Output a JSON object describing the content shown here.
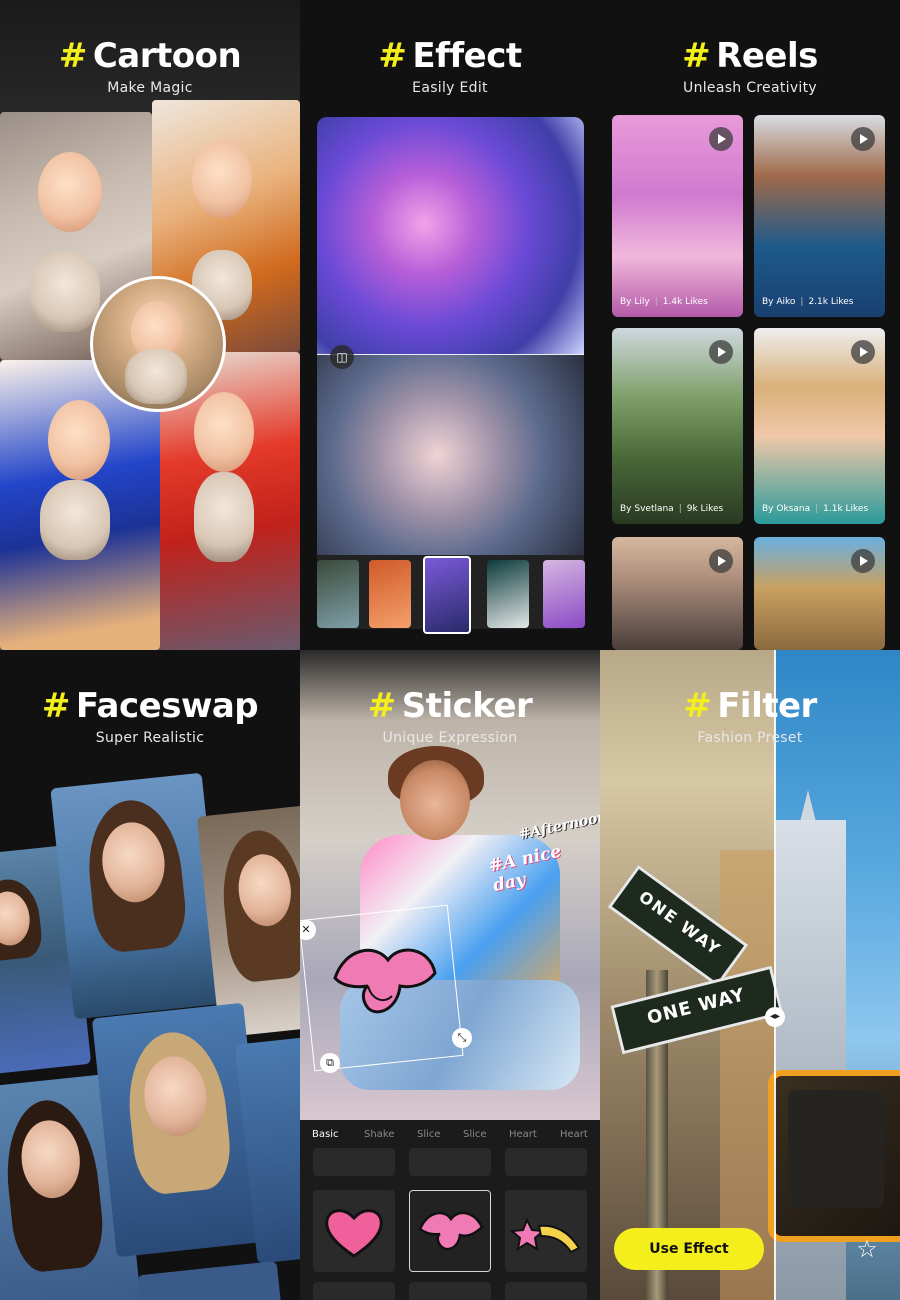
{
  "panels": [
    {
      "hash": "#",
      "title": "Cartoon",
      "subtitle": "Make Magic"
    },
    {
      "hash": "#",
      "title": "Effect",
      "subtitle": "Easily Edit"
    },
    {
      "hash": "#",
      "title": "Reels",
      "subtitle": "Unleash Creativity"
    },
    {
      "hash": "#",
      "title": "Faceswap",
      "subtitle": "Super Realistic"
    },
    {
      "hash": "#",
      "title": "Sticker",
      "subtitle": "Unique Expression"
    },
    {
      "hash": "#",
      "title": "Filter",
      "subtitle": "Fashion Preset"
    }
  ],
  "reels": [
    {
      "author": "By Lily",
      "likes": "1.4k Likes"
    },
    {
      "author": "By Aiko",
      "likes": "2.1k Likes"
    },
    {
      "author": "By Svetlana",
      "likes": "9k Likes"
    },
    {
      "author": "By Oksana",
      "likes": "1.1k Likes"
    }
  ],
  "sticker": {
    "overlay_text_1": "#Afternoon",
    "overlay_text_2": "#A nice day",
    "tabs": [
      "Basic",
      "Shake",
      "Slice",
      "Slice",
      "Heart",
      "Heart"
    ]
  },
  "filter": {
    "sign_1": "ONE WAY",
    "sign_2": "ONE WAY",
    "use_button": "Use Effect"
  },
  "colors": {
    "accent": "#f4ee1d",
    "background": "#111111"
  },
  "icons": {
    "play": "play-icon",
    "split": "split-compare-icon",
    "star": "star-outline-icon",
    "close": "close-icon",
    "scale": "resize-icon",
    "duplicate": "duplicate-icon"
  }
}
